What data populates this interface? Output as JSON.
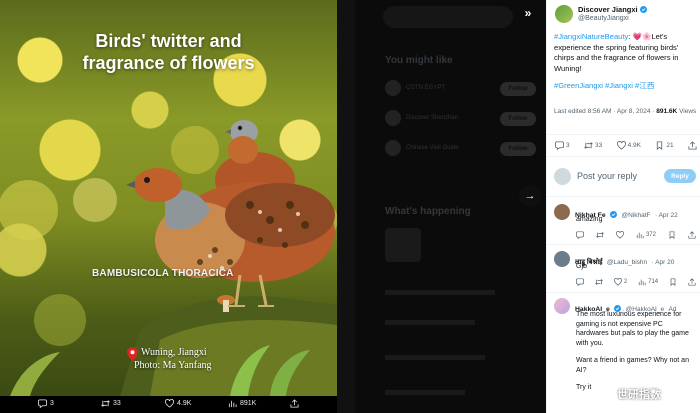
{
  "media": {
    "title_line1": "Birds' twitter and",
    "title_line2": "fragrance of flowers",
    "species": "BAMBUSICOLA THORACICA",
    "location": "Wuning, Jiangxi",
    "photo_credit": "Photo: Ma Yanfang",
    "actions": {
      "replies": "3",
      "retweets": "33",
      "likes": "4.9K",
      "views": "891K"
    }
  },
  "backdrop": {
    "you_might_like": "You might like",
    "whats_happening": "What's happening",
    "suggestions": [
      {
        "name": "CGTN EGYPT",
        "btn": "Follow"
      },
      {
        "name": "Discover Shenzhen",
        "btn": "Follow"
      },
      {
        "name": "Chinese Visit Guide",
        "btn": "Follow"
      }
    ]
  },
  "tweet": {
    "author_name": "Discover Jiangxi",
    "author_handle": "@BeautyJiangxi",
    "hashtag1": "#JiangxiNatureBeauty",
    "text": ": 💗🌸Let's experience the spring featuring birds' chirps and the fragrance of flowers in Wuning!",
    "hashtags2": "#GreenJiangxi #Jiangxi #江西",
    "last_edited": "Last edited 8:56 AM · Apr 8, 2024",
    "views_count": "891.6K",
    "views_label": "Views",
    "stats": {
      "replies": "3",
      "retweets": "33",
      "likes": "4.9K",
      "bookmarks": "21"
    }
  },
  "reply_box": {
    "placeholder": "Post your reply",
    "button": "Reply"
  },
  "replies": [
    {
      "name": "Nikhat Fe",
      "handle": "@NikhatF",
      "date": "· Apr 22",
      "text": "amazing",
      "views": "372"
    },
    {
      "name": "लाडू बिश्नोई",
      "handle": "@Ladu_bishn",
      "date": "· Apr 20",
      "text": "Gjb",
      "likes": "2",
      "views": "714"
    },
    {
      "name": "HakkoAI_e",
      "handle": "@HakkoAI_e",
      "ad": "Ad",
      "text": "The most luxurious experience for gaming is not expensive PC hardwares but pals to play the game with you.",
      "text2": "Want a friend in games? Why not an AI?",
      "text3": "Try it"
    }
  ],
  "watermark": "世研指数",
  "colors": {
    "accent": "#1d9bf0",
    "like": "#f91880"
  }
}
